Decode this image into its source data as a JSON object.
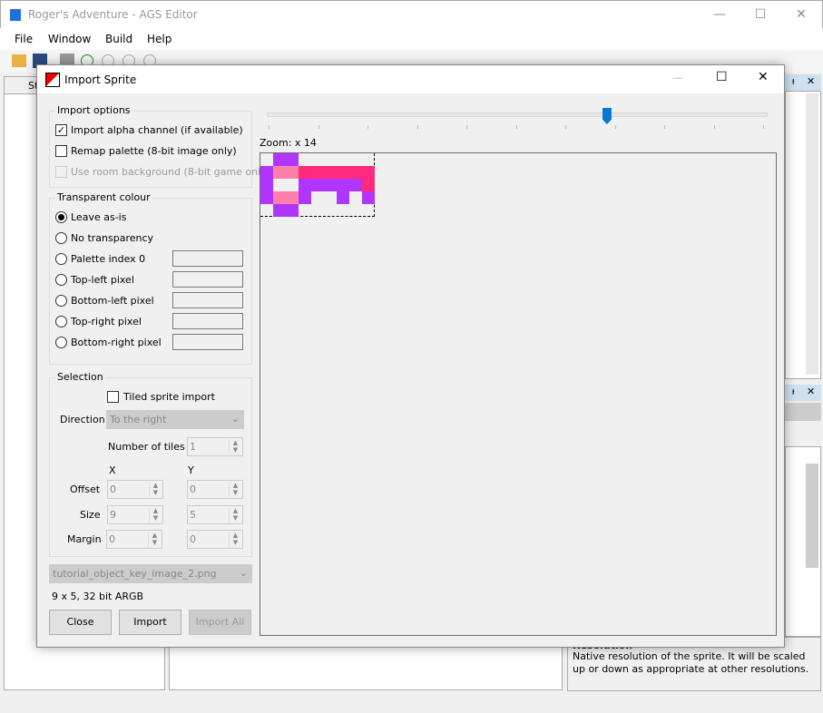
{
  "window": {
    "title": "Roger's Adventure - AGS Editor",
    "minimize": "—",
    "maximize": "☐",
    "close": "✕"
  },
  "menu": [
    "File",
    "Window",
    "Build",
    "Help"
  ],
  "left_tab": "St",
  "right_panel": {
    "pin": "ᵼ",
    "close": "✕",
    "description_title": "Resolution",
    "description": "Native resolution of the sprite. It will be scaled up or down as appropriate at other resolutions."
  },
  "dialog": {
    "title": "Import Sprite",
    "maximize": "☐",
    "close": "✕",
    "import_options": {
      "legend": "Import options",
      "alpha": {
        "label": "Import alpha channel (if available)",
        "checked": true
      },
      "remap": {
        "label": "Remap palette (8-bit image only)",
        "checked": false
      },
      "room_bg": {
        "label": "Use room background (8-bit game only)",
        "checked": false,
        "disabled": true
      }
    },
    "transparent": {
      "legend": "Transparent colour",
      "options": [
        "Leave as-is",
        "No transparency",
        "Palette index 0",
        "Top-left pixel",
        "Bottom-left pixel",
        "Top-right pixel",
        "Bottom-right pixel"
      ],
      "selected": 0
    },
    "selection": {
      "legend": "Selection",
      "tiled_label": "Tiled sprite import",
      "tiled": false,
      "direction_label": "Direction",
      "direction": "To the right",
      "tiles_label": "Number of tiles",
      "tiles": "1",
      "x_label": "X",
      "y_label": "Y",
      "offset_label": "Offset",
      "offset": [
        "0",
        "0"
      ],
      "size_label": "Size",
      "size": [
        "9",
        "5"
      ],
      "margin_label": "Margin",
      "margin": [
        "0",
        "0"
      ]
    },
    "file": "tutorial_object_key_image_2.png",
    "info": "9 x 5, 32 bit ARGB",
    "buttons": {
      "close": "Close",
      "import": "Import",
      "import_all": "Import All"
    },
    "zoom": {
      "label": "Zoom: x 14",
      "value": 14,
      "min": 1,
      "max": 20
    },
    "sprite": {
      "colors": {
        "P": "#b035ff",
        "H": "#ff2a7c",
        "L": "#ff80ab"
      },
      "rows": [
        ".PP......",
        "PLLHHHHHH",
        "P..PPPPPH",
        "PLLP..P.P",
        ".PP......"
      ]
    }
  }
}
